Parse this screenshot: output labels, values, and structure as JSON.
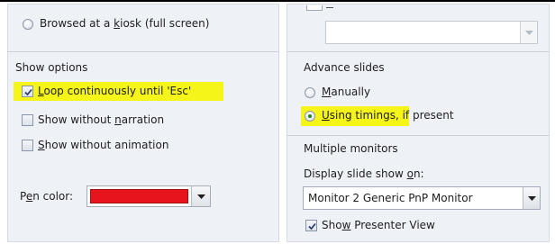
{
  "kiosk_option": {
    "label_pre": "Browsed at a ",
    "label_u": "k",
    "label_post": "iosk (full screen)"
  },
  "show_options": {
    "title": "Show options",
    "loop": {
      "u": "L",
      "rest": "oop continuously until 'Esc'",
      "checked": true
    },
    "no_narration": {
      "pre": "Show without ",
      "u": "n",
      "post": "arration",
      "checked": false
    },
    "no_animation": {
      "u": "S",
      "rest": "how without animation",
      "checked": false
    },
    "pen_color": {
      "pre": "P",
      "u": "e",
      "post": "n color:",
      "color": "#e8141b"
    }
  },
  "advance_slides": {
    "title": "Advance slides",
    "manually": {
      "u": "M",
      "rest": "anually",
      "selected": false
    },
    "timings": {
      "u": "U",
      "mid": "sing tim",
      "rest": "ings, if present",
      "selected": true
    }
  },
  "multiple_monitors": {
    "title": "Multiple monitors",
    "display_on": {
      "pre": "Display slide show ",
      "u": "o",
      "post": "n:"
    },
    "monitor_value": "Monitor 2 Generic PnP Monitor",
    "presenter": {
      "pre": "Sho",
      "u": "w",
      "post": " Presenter View",
      "checked": true
    }
  },
  "colors": {
    "highlight": "#f5f51a",
    "pane_bg": "#eef1f6",
    "radio_dot": "#1b8a1b"
  }
}
